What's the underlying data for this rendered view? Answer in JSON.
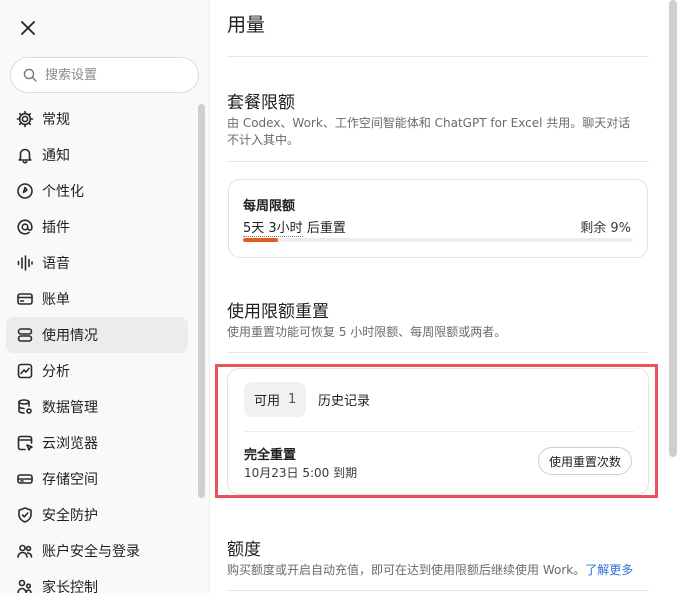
{
  "sidebar": {
    "search_placeholder": "搜索设置",
    "items": [
      {
        "label": "常规",
        "icon": "gear-icon"
      },
      {
        "label": "通知",
        "icon": "bell-icon"
      },
      {
        "label": "个性化",
        "icon": "palette-icon"
      },
      {
        "label": "插件",
        "icon": "at-icon"
      },
      {
        "label": "语音",
        "icon": "waveform-icon"
      },
      {
        "label": "账单",
        "icon": "card-icon"
      },
      {
        "label": "使用情况",
        "icon": "usage-icon",
        "active": true
      },
      {
        "label": "分析",
        "icon": "chart-icon"
      },
      {
        "label": "数据管理",
        "icon": "database-icon"
      },
      {
        "label": "云浏览器",
        "icon": "browser-icon"
      },
      {
        "label": "存储空间",
        "icon": "storage-icon"
      },
      {
        "label": "安全防护",
        "icon": "shield-icon"
      },
      {
        "label": "账户安全与登录",
        "icon": "people-icon"
      },
      {
        "label": "家长控制",
        "icon": "parent-icon"
      }
    ]
  },
  "main": {
    "title": "用量",
    "plan_limits": {
      "title": "套餐限额",
      "desc": "由 Codex、Work、工作空间智能体和 ChatGPT for Excel 共用。聊天对话不计入其中。",
      "weekly": {
        "label": "每周限额",
        "reset_duration": "5天 3小时",
        "reset_suffix": " 后重置",
        "remaining": "剩余 9%",
        "used_fraction": 0.09,
        "bar_color": "#e05d1c"
      }
    },
    "reset": {
      "title": "使用限额重置",
      "desc": "使用重置功能可恢复 5 小时限额、每周限额或两者。",
      "tab_available": "可用",
      "available_count": "1",
      "tab_history": "历史记录",
      "item_title": "完全重置",
      "item_expiry": "10月23日 5:00 到期",
      "button": "使用重置次数"
    },
    "credits": {
      "title": "额度",
      "desc": "购买额度或开启自动充值，即可在达到使用限额后继续使用 Work。",
      "link": "了解更多"
    }
  }
}
